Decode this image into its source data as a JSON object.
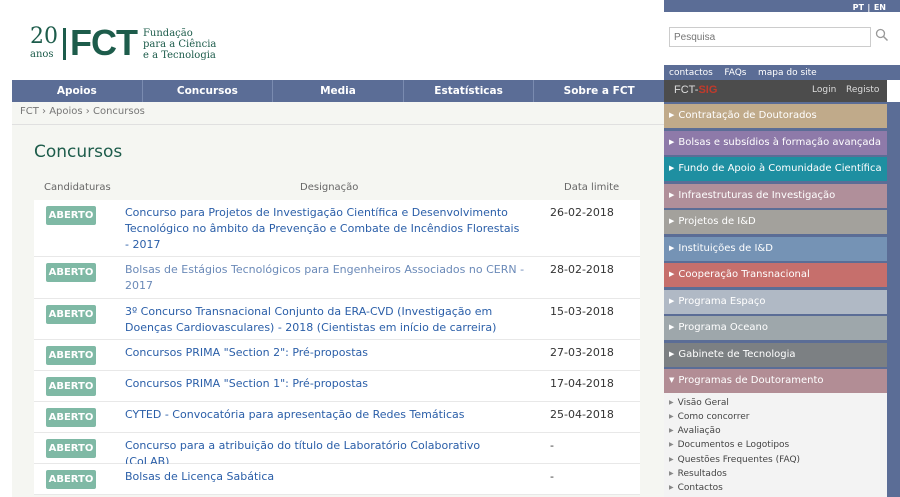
{
  "logo": {
    "years": "20",
    "years_word": "anos",
    "brand": "FCT",
    "subtitle_1": "Fundação",
    "subtitle_2": "para a Ciência",
    "subtitle_3": "e a Tecnologia"
  },
  "lang": {
    "pt": "PT",
    "sep": "|",
    "en": "EN"
  },
  "search": {
    "placeholder": "Pesquisa"
  },
  "sublinks": [
    "contactos",
    "FAQs",
    "mapa do site"
  ],
  "nav": [
    "Apoios",
    "Concursos",
    "Media",
    "Estatísticas",
    "Sobre a FCT"
  ],
  "fctsig": {
    "logo_a": "FCT-",
    "logo_b": "SIG",
    "login": "Login",
    "register": "Registo"
  },
  "breadcrumb": "FCT › Apoios › Concursos",
  "page_title": "Concursos",
  "table": {
    "headers": {
      "status": "Candidaturas",
      "title": "Designação",
      "date": "Data limite"
    },
    "rows": [
      {
        "status": "ABERTO",
        "title": "Concurso para Projetos de Investigação Científica e Desenvolvimento Tecnológico no âmbito da Prevenção e Combate de Incêndios Florestais - 2017",
        "date": "26-02-2018"
      },
      {
        "status": "ABERTO",
        "title": "Bolsas de Estágios Tecnológicos para Engenheiros Associados no CERN - 2017",
        "date": "28-02-2018"
      },
      {
        "status": "ABERTO",
        "title": "3º Concurso Transnacional Conjunto da ERA-CVD (Investigação em Doenças Cardiovasculares) - 2018 (Cientistas em início de carreira)",
        "date": "15-03-2018"
      },
      {
        "status": "ABERTO",
        "title": "Concursos PRIMA \"Section 2\": Pré-propostas",
        "date": "27-03-2018"
      },
      {
        "status": "ABERTO",
        "title": "Concursos PRIMA \"Section 1\": Pré-propostas",
        "date": "17-04-2018"
      },
      {
        "status": "ABERTO",
        "title": "CYTED - Convocatória para apresentação de Redes Temáticas",
        "date": "25-04-2018"
      },
      {
        "status": "ABERTO",
        "title": "Concurso para a atribuição do título de Laboratório Colaborativo (CoLAB)",
        "date": "-"
      },
      {
        "status": "ABERTO",
        "title": "Bolsas de Licença Sabática",
        "date": "-"
      }
    ]
  },
  "sidebar": {
    "items": [
      {
        "label": "Contratação de Doutorados",
        "color": "#c0aa8a"
      },
      {
        "label": "Bolsas e subsídios à formação avançada",
        "color": "#8e7aa9"
      },
      {
        "label": "Fundo de Apoio à Comunidade Científica",
        "color": "#1e8fa1"
      },
      {
        "label": "Infraestruturas de Investigação",
        "color": "#b08f9a"
      },
      {
        "label": "Projetos de I&D",
        "color": "#a3a19c"
      },
      {
        "label": "Instituições de I&D",
        "color": "#7593b5"
      },
      {
        "label": "Cooperação Transnacional",
        "color": "#c66f6c"
      },
      {
        "label": "Programa Espaço",
        "color": "#b0b9c5"
      },
      {
        "label": "Programa Oceano",
        "color": "#9ea7ab"
      },
      {
        "label": "Gabinete de Tecnologia",
        "color": "#7c8083"
      },
      {
        "label": "Programas de Doutoramento",
        "color": "#b28d95"
      }
    ],
    "sub_items": [
      "Visão Geral",
      "Como concorrer",
      "Avaliação",
      "Documentos e Logotipos",
      "Questões Frequentes (FAQ)",
      "Resultados",
      "Contactos"
    ]
  }
}
